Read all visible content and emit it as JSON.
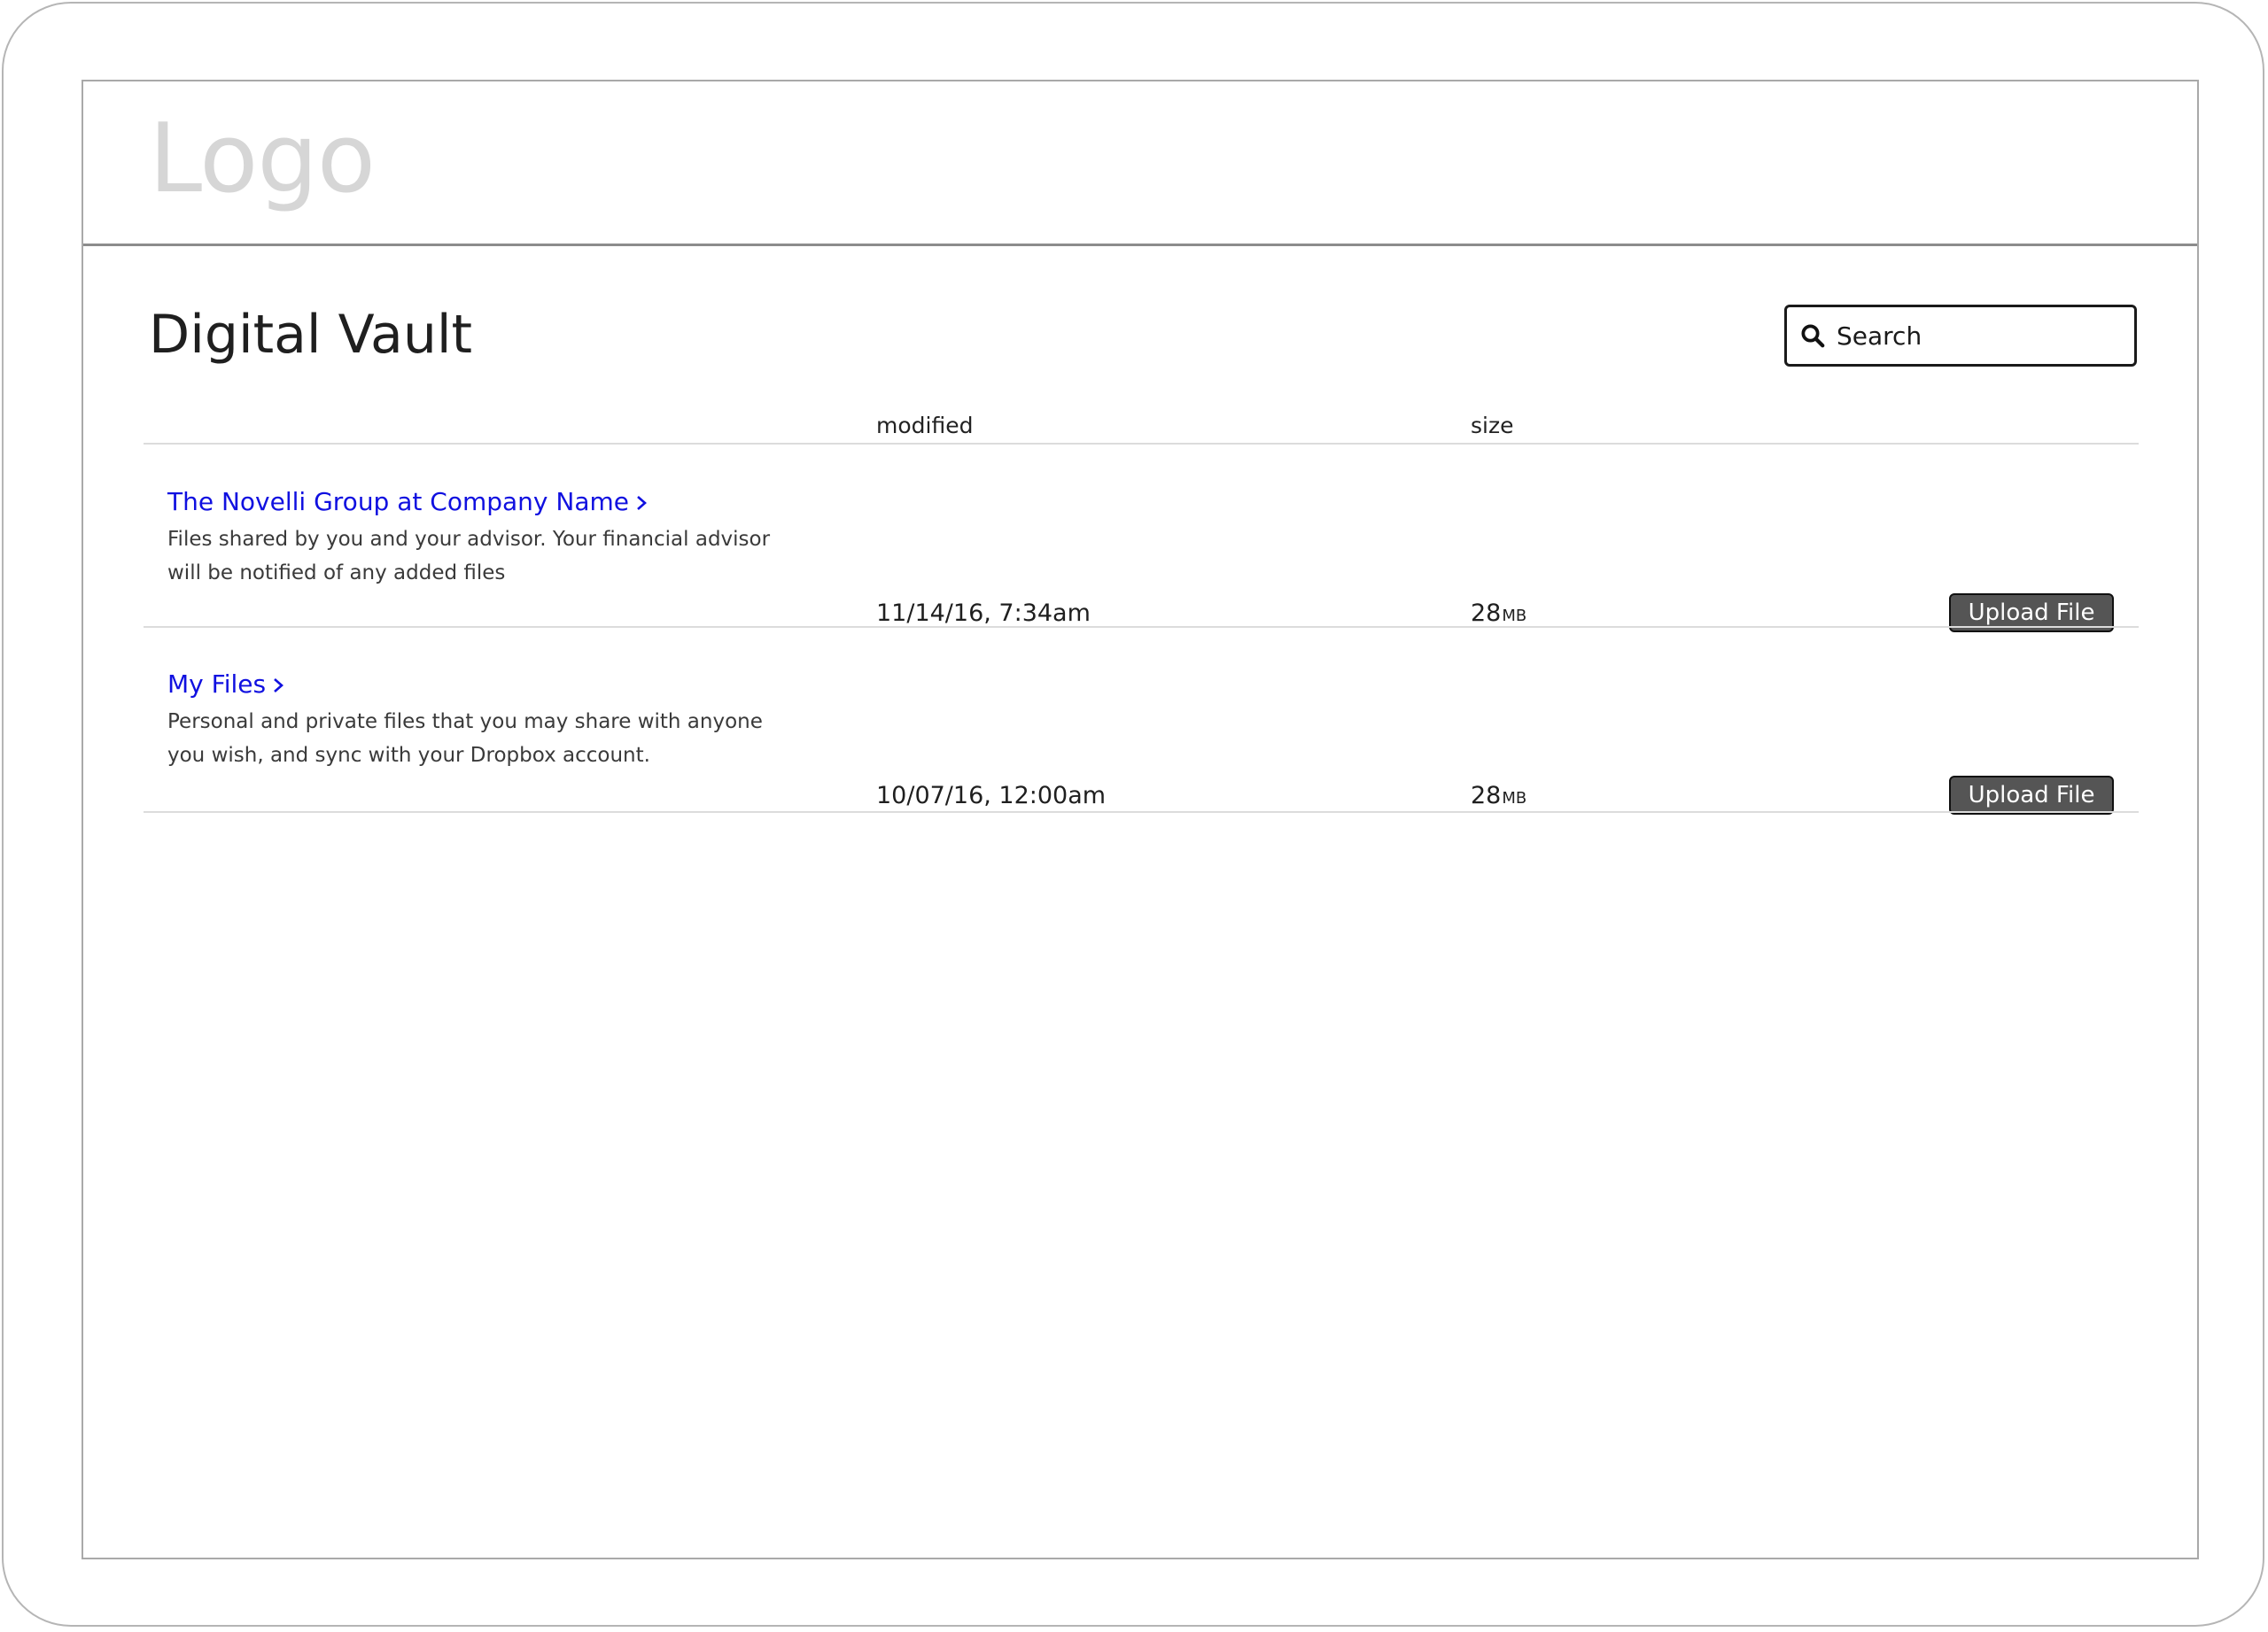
{
  "header": {
    "logo_text": "Logo"
  },
  "page": {
    "title": "Digital Vault"
  },
  "search": {
    "placeholder": "Search",
    "icon": "search-icon"
  },
  "table": {
    "columns": {
      "modified": "modified",
      "size": "size"
    },
    "rows": [
      {
        "title": "The Novelli Group at Company Name",
        "description": "Files shared by you and your advisor. Your financial advisor will be notified of any added files",
        "modified": "11/14/16, 7:34am",
        "size_value": "28",
        "size_unit": "MB",
        "action_label": "Upload File"
      },
      {
        "title": "My Files",
        "description": "Personal and private files that you may share with anyone you wish, and sync with your Dropbox account.",
        "modified": "10/07/16, 12:00am",
        "size_value": "28",
        "size_unit": "MB",
        "action_label": "Upload File"
      }
    ]
  },
  "colors": {
    "link": "#1010e0",
    "button_bg": "#555555",
    "logo": "#d6d6d6"
  }
}
